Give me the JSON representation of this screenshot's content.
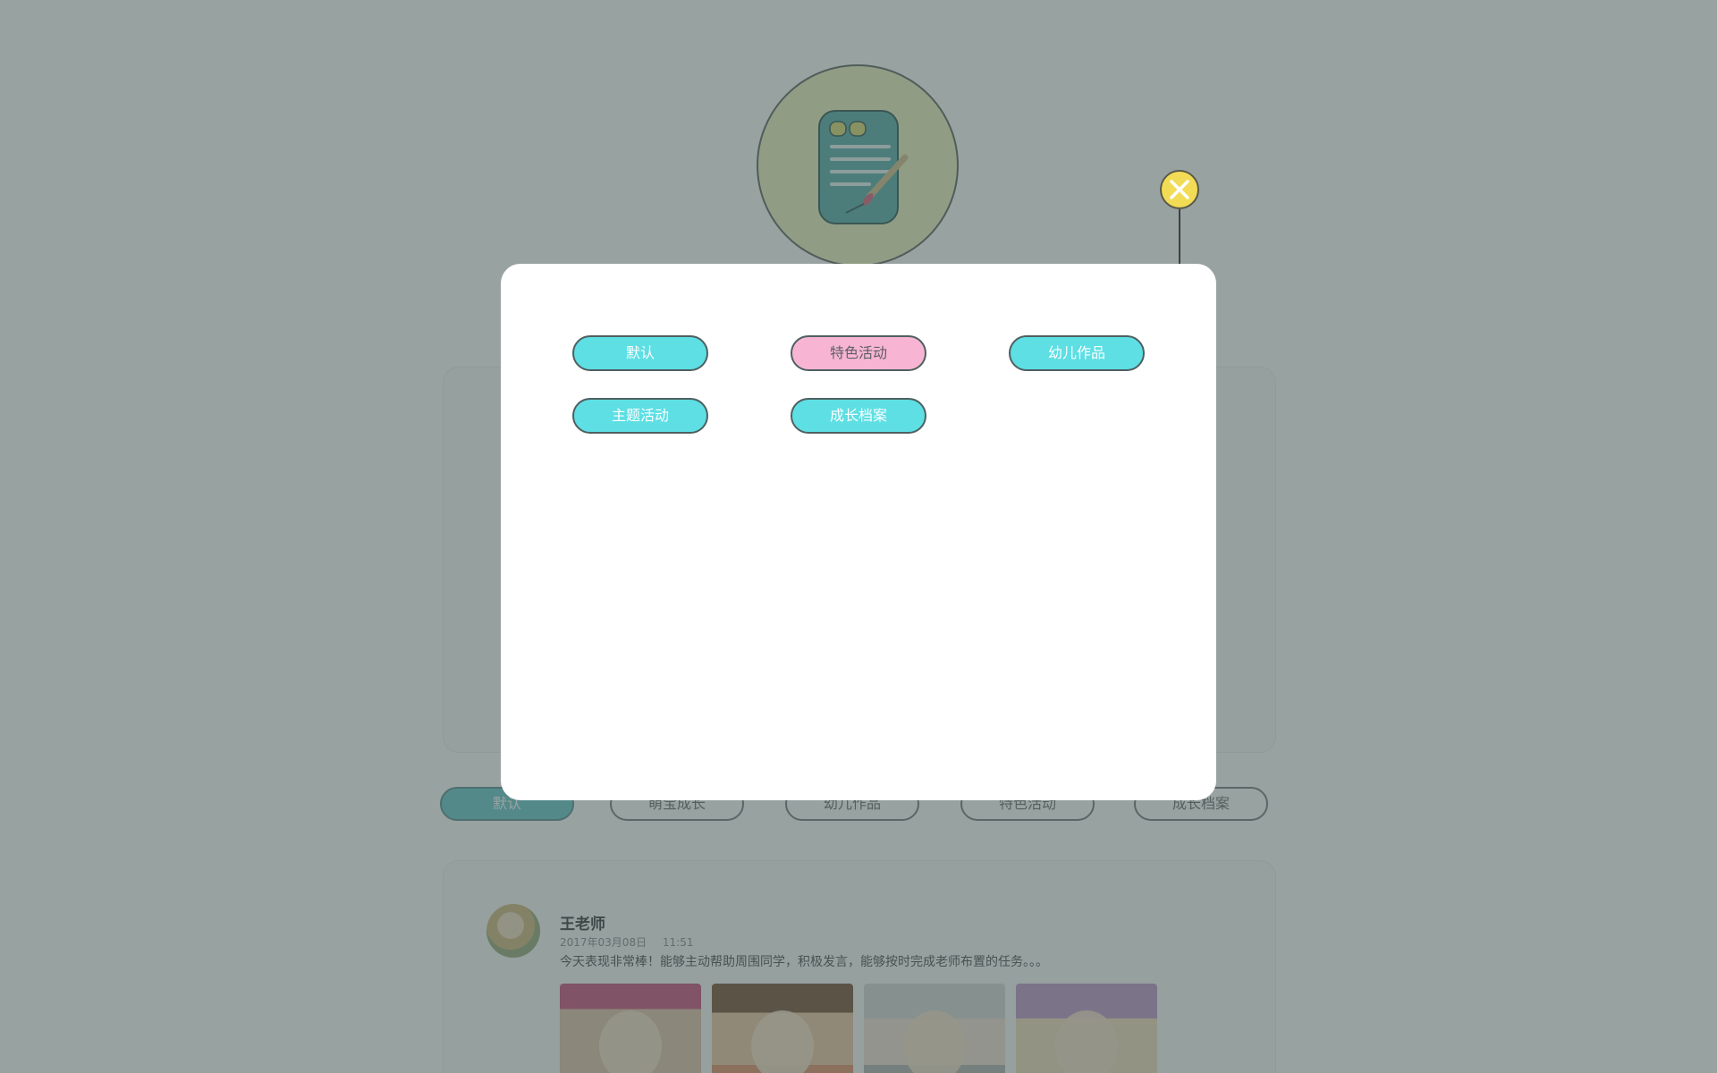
{
  "categories_modal": {
    "buttons": [
      {
        "label": "默认",
        "style": "teal"
      },
      {
        "label": "特色活动",
        "style": "pink"
      },
      {
        "label": "幼儿作品",
        "style": "teal"
      },
      {
        "label": "主题活动",
        "style": "teal"
      },
      {
        "label": "成长档案",
        "style": "teal"
      }
    ],
    "close_icon": "close-icon"
  },
  "tabs": [
    {
      "label": "默认",
      "active": true
    },
    {
      "label": "萌宝成长"
    },
    {
      "label": "幼儿作品"
    },
    {
      "label": "特色活动"
    },
    {
      "label": "成长档案"
    }
  ],
  "feed": {
    "teacher_name": "王老师",
    "date": "2017年03月08日",
    "time": "11:51",
    "text": "今天表现非常棒！能够主动帮助周围同学，积极发言，能够按时完成老师布置的任务。。。"
  },
  "colors": {
    "overlay": "#283c3a",
    "teal_button": "#5ddfe4",
    "pink_button": "#f7b5d3",
    "close_button": "#f2dc55",
    "icon_circle": "#f2f3ca"
  },
  "icons": [
    "notebook-icon",
    "close-icon"
  ]
}
